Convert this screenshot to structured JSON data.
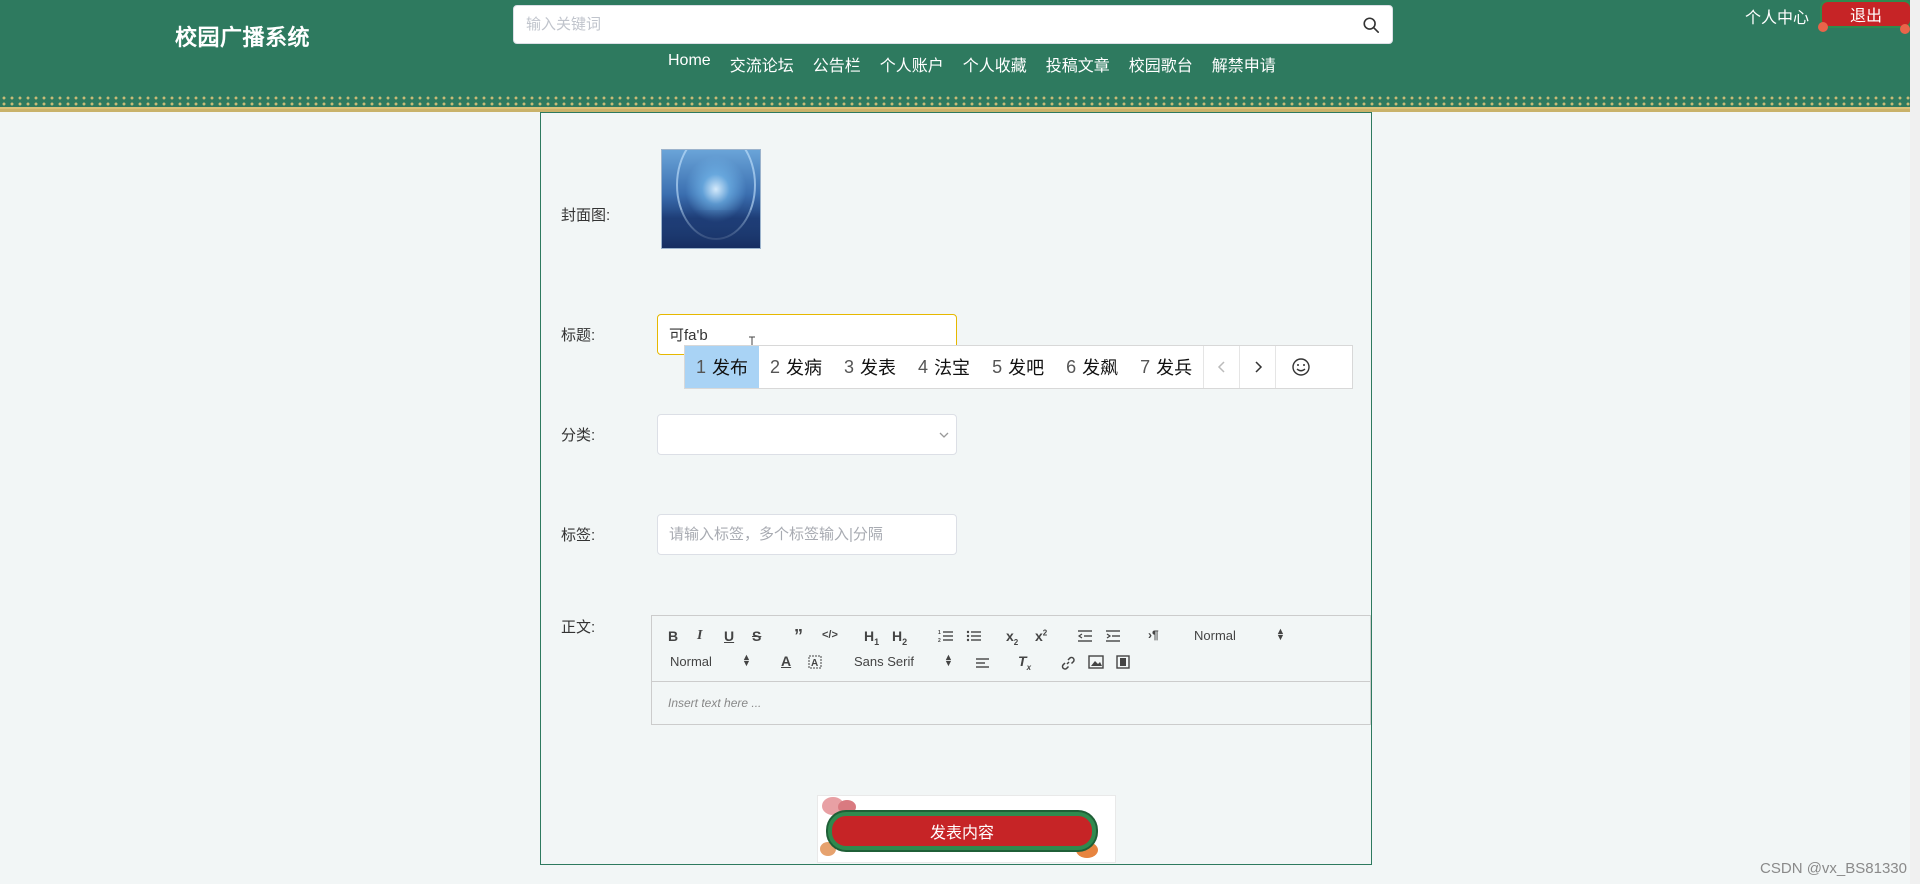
{
  "header": {
    "brand": "校园广播系统",
    "search_placeholder": "输入关键词",
    "nav": [
      "Home",
      "交流论坛",
      "公告栏",
      "个人账户",
      "个人收藏",
      "投稿文章",
      "校园歌台",
      "解禁申请"
    ],
    "user_center": "个人中心",
    "logout": "退出"
  },
  "form": {
    "cover_label": "封面图:",
    "title_label": "标题:",
    "title_value": "可fa'b",
    "category_label": "分类:",
    "tags_label": "标签:",
    "tags_placeholder": "请输入标签，多个标签输入|分隔",
    "body_label": "正文:",
    "editor": {
      "header_select": "Normal",
      "size_select": "Normal",
      "font_select": "Sans Serif",
      "placeholder": "Insert text here ..."
    },
    "submit": "发表内容"
  },
  "ime": {
    "candidates": [
      {
        "n": "1",
        "text": "发布"
      },
      {
        "n": "2",
        "text": "发病"
      },
      {
        "n": "3",
        "text": "发表"
      },
      {
        "n": "4",
        "text": "法宝"
      },
      {
        "n": "5",
        "text": "发吧"
      },
      {
        "n": "6",
        "text": "发飙"
      },
      {
        "n": "7",
        "text": "发兵"
      }
    ],
    "selected_index": 0
  },
  "icons": {
    "search": "search-icon",
    "dropdown": "chevron-down-icon",
    "emoji": "smiley-icon",
    "prev": "chevron-left-icon",
    "next": "chevron-right-icon"
  },
  "colors": {
    "header_bg": "#2e7a5f",
    "accent_red": "#c62426",
    "accent_gold": "#d9c27a",
    "ime_selected": "#a9d3f5"
  },
  "watermark": "CSDN @vx_BS81330"
}
